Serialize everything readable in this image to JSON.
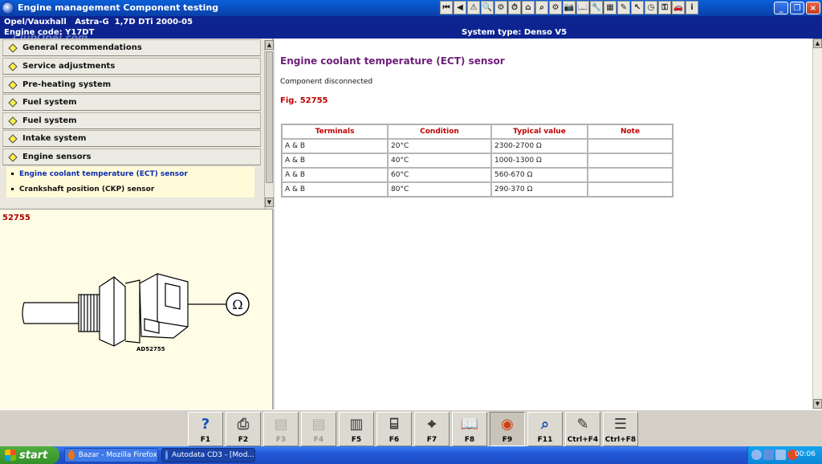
{
  "window": {
    "title": "Engine management Component testing",
    "toolbar_icons": [
      "first-page-icon",
      "previous-page-icon",
      "warning-icon",
      "zoom-icon",
      "settings-icon",
      "timer-icon",
      "home-icon",
      "search-icon",
      "engine-icon",
      "camera-icon",
      "book-icon",
      "wrench-icon",
      "calendar-icon",
      "notes-icon",
      "cursor-icon",
      "clock-icon",
      "key-icon",
      "car-icon",
      "info-icon"
    ],
    "toolbar_glyphs": [
      "⏮",
      "◀",
      "⚠",
      "🔍",
      "⚙",
      "⏱",
      "⌂",
      "⌕",
      "⚙",
      "📷",
      "📖",
      "🔧",
      "▦",
      "✎",
      "↖",
      "◷",
      "⚿",
      "🚗",
      "i"
    ],
    "controls": {
      "minimize": "_",
      "restore": "❐",
      "close": "×"
    }
  },
  "vehicle_info": {
    "vehicle": "Opel/Vauxhall   Astra-G  1,7D DTi 2000-05",
    "engine_code": "Engine code: Y17DT",
    "system_type": "System type: Denso V5",
    "watermark": "ClubOpel.com"
  },
  "menu": {
    "items": [
      {
        "label": "General recommendations"
      },
      {
        "label": "Service adjustments"
      },
      {
        "label": "Pre-heating system"
      },
      {
        "label": "Fuel system"
      },
      {
        "label": "Fuel system"
      },
      {
        "label": "Intake system"
      },
      {
        "label": "Engine sensors"
      }
    ],
    "submenu": [
      {
        "label": "Engine coolant temperature (ECT) sensor",
        "active": true
      },
      {
        "label": "Crankshaft position (CKP) sensor",
        "active": false
      }
    ],
    "scroll_up": "▲",
    "scroll_down": "▼"
  },
  "figure": {
    "number": "52755",
    "caption": "AD52755",
    "ohm_symbol": "Ω"
  },
  "content": {
    "title": "Engine coolant temperature (ECT) sensor",
    "status": "Component disconnected",
    "fig_ref": "Fig. 52755",
    "table": {
      "headers": [
        "Terminals",
        "Condition",
        "Typical value",
        "Note"
      ],
      "rows": [
        [
          "A & B",
          "20°C",
          "2300-2700 Ω",
          ""
        ],
        [
          "A & B",
          "40°C",
          "1000-1300 Ω",
          ""
        ],
        [
          "A & B",
          "60°C",
          "560-670 Ω",
          ""
        ],
        [
          "A & B",
          "80°C",
          "290-370 Ω",
          ""
        ]
      ]
    }
  },
  "function_keys": [
    {
      "label": "F1",
      "icon": "help-icon",
      "glyph": "?",
      "color": "#1a4fb8",
      "enabled": true,
      "pressed": false
    },
    {
      "label": "F2",
      "icon": "print-icon",
      "glyph": "⎙",
      "color": "#555555",
      "enabled": true,
      "pressed": false
    },
    {
      "label": "F3",
      "icon": "view-icon",
      "glyph": "▤",
      "color": "#777777",
      "enabled": false,
      "pressed": false
    },
    {
      "label": "F4",
      "icon": "component-icon",
      "glyph": "▤",
      "color": "#777777",
      "enabled": false,
      "pressed": false
    },
    {
      "label": "F5",
      "icon": "document-icon",
      "glyph": "▥",
      "color": "#333333",
      "enabled": true,
      "pressed": false
    },
    {
      "label": "F6",
      "icon": "connector-icon",
      "glyph": "⌸",
      "color": "#333333",
      "enabled": true,
      "pressed": false
    },
    {
      "label": "F7",
      "icon": "probe-icon",
      "glyph": "⌖",
      "color": "#333333",
      "enabled": true,
      "pressed": false
    },
    {
      "label": "F8",
      "icon": "manual-icon",
      "glyph": "📖",
      "color": "#333333",
      "enabled": true,
      "pressed": false
    },
    {
      "label": "F9",
      "icon": "sensor-icon",
      "glyph": "◉",
      "color": "#d04010",
      "enabled": true,
      "pressed": true
    },
    {
      "label": "F11",
      "icon": "diagnostic-icon",
      "glyph": "⌕",
      "color": "#1a4fb8",
      "enabled": true,
      "pressed": false
    },
    {
      "label": "Ctrl+F4",
      "icon": "notepad-icon",
      "glyph": "✎",
      "color": "#333333",
      "enabled": true,
      "pressed": false
    },
    {
      "label": "Ctrl+F8",
      "icon": "list-icon",
      "glyph": "☰",
      "color": "#333333",
      "enabled": true,
      "pressed": false
    }
  ],
  "taskbar": {
    "start": "start",
    "tasks": [
      {
        "label": "Bazar - Mozilla Firefox",
        "color": "#e8751a"
      },
      {
        "label": "Autodata CD3 - [Mod...",
        "color": "#2a5fd0"
      }
    ],
    "tray_icons": [
      "back-icon",
      "network-icon",
      "volume-icon",
      "security-icon"
    ],
    "clock": "00:06"
  },
  "colors": {
    "title_bar": "#0a4fc8",
    "info_bar": "#0d2490",
    "heading": "#6e1f7a",
    "figure_red": "#c00000",
    "figure_background": "#fffde6"
  }
}
